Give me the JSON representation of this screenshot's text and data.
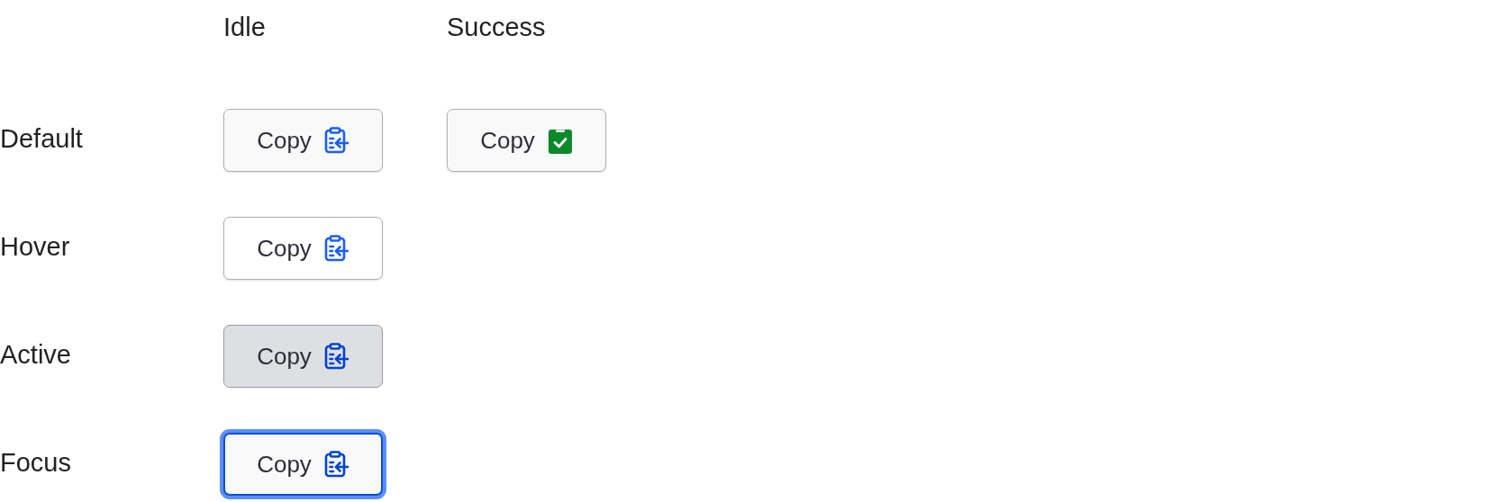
{
  "columns": [
    {
      "label": "Idle"
    },
    {
      "label": "Success"
    }
  ],
  "rows": [
    {
      "label": "Default",
      "buttons": [
        {
          "text": "Copy",
          "kind": "default",
          "success": false
        },
        {
          "text": "Copy",
          "kind": "default",
          "success": true
        }
      ]
    },
    {
      "label": "Hover",
      "buttons": [
        {
          "text": "Copy",
          "kind": "hover",
          "success": false
        }
      ]
    },
    {
      "label": "Active",
      "buttons": [
        {
          "text": "Copy",
          "kind": "active",
          "success": false
        }
      ]
    },
    {
      "label": "Focus",
      "buttons": [
        {
          "text": "Copy",
          "kind": "focus",
          "success": false
        }
      ]
    }
  ]
}
